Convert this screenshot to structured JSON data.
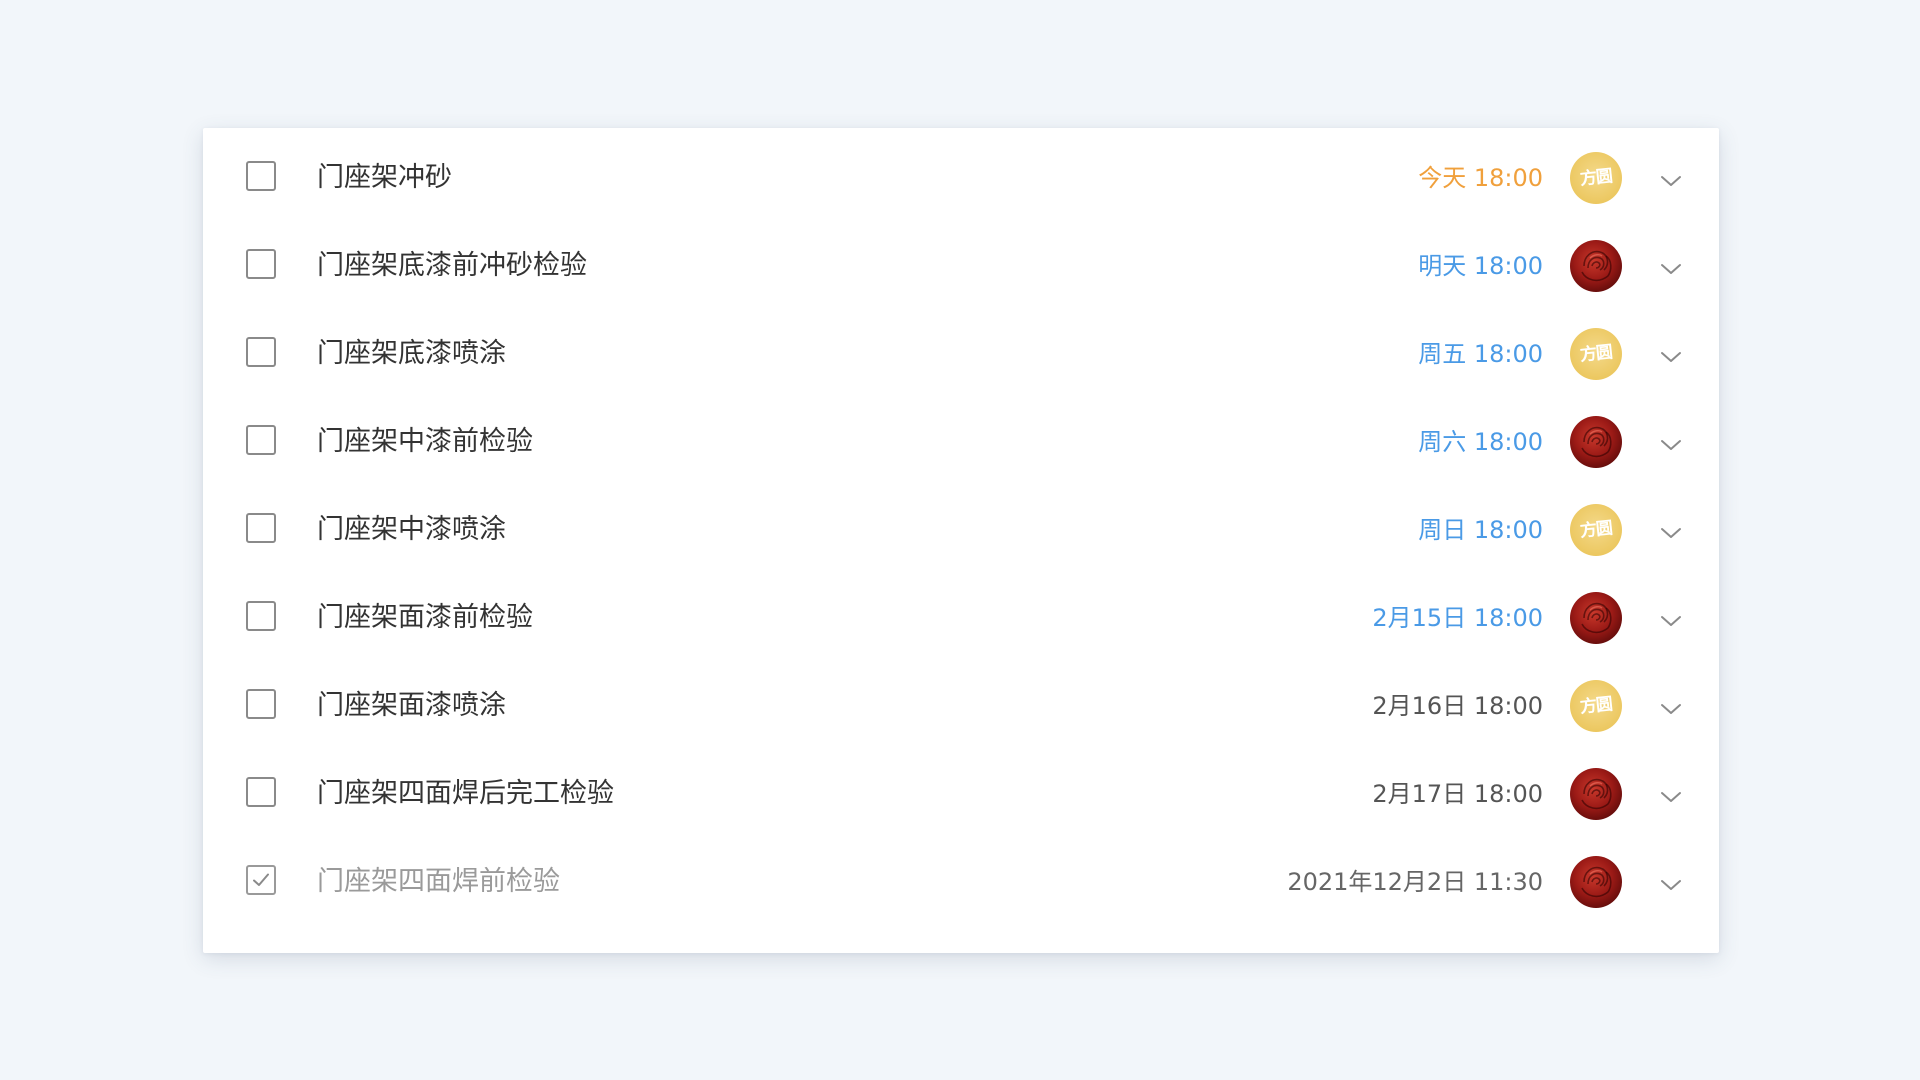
{
  "colors": {
    "today": "#f0a03c",
    "upcoming": "#4a9ae6",
    "normal": "#555555",
    "past": "#666666",
    "avatar_yellow": "#ecc861",
    "avatar_rose": "#9b1a16"
  },
  "tasks": [
    {
      "title": "门座架冲砂",
      "due": "今天 18:00",
      "due_style": "today",
      "avatar": "yellow",
      "avatar_text": "方圆",
      "checked": false
    },
    {
      "title": "门座架底漆前冲砂检验",
      "due": "明天 18:00",
      "due_style": "upcoming",
      "avatar": "rose",
      "avatar_text": "",
      "checked": false
    },
    {
      "title": "门座架底漆喷涂",
      "due": "周五 18:00",
      "due_style": "upcoming",
      "avatar": "yellow",
      "avatar_text": "方圆",
      "checked": false
    },
    {
      "title": "门座架中漆前检验",
      "due": "周六 18:00",
      "due_style": "upcoming",
      "avatar": "rose",
      "avatar_text": "",
      "checked": false
    },
    {
      "title": "门座架中漆喷涂",
      "due": "周日 18:00",
      "due_style": "upcoming",
      "avatar": "yellow",
      "avatar_text": "方圆",
      "checked": false
    },
    {
      "title": "门座架面漆前检验",
      "due": "2月15日 18:00",
      "due_style": "upcoming",
      "avatar": "rose",
      "avatar_text": "",
      "checked": false
    },
    {
      "title": "门座架面漆喷涂",
      "due": "2月16日 18:00",
      "due_style": "normal",
      "avatar": "yellow",
      "avatar_text": "方圆",
      "checked": false
    },
    {
      "title": "门座架四面焊后完工检验",
      "due": "2月17日 18:00",
      "due_style": "normal",
      "avatar": "rose",
      "avatar_text": "",
      "checked": false
    },
    {
      "title": "门座架四面焊前检验",
      "due": "2021年12月2日 11:30",
      "due_style": "past",
      "avatar": "rose",
      "avatar_text": "",
      "checked": true
    }
  ],
  "icons": {
    "checkbox_empty": "checkbox-empty-icon",
    "checkbox_checked": "checkmark-icon",
    "expand": "chevron-down-icon"
  }
}
